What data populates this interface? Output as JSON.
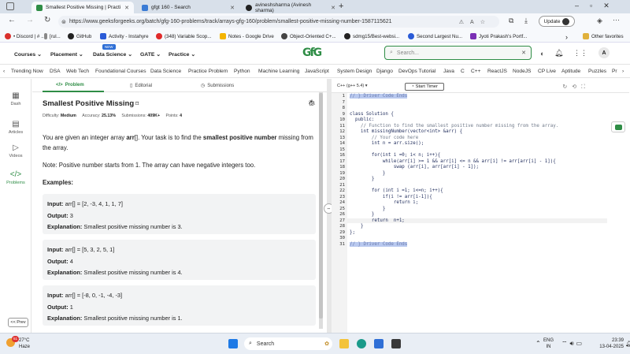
{
  "browser": {
    "tabs": [
      {
        "title": "Smallest Positive Missing | Practi",
        "active": true
      },
      {
        "title": "gfgt 160 - Search",
        "active": false
      },
      {
        "title": "avineshsharma (Avinesh sharma)",
        "active": false
      }
    ],
    "url": "https://www.geeksforgeeks.org/batch/gfg-160-problems/track/arrays-gfg-160/problem/smallest-positive-missing-number-1587115621",
    "update_label": "Update",
    "bookmarks": [
      "• Discord | # ...",
      "[rul...",
      "GitHub",
      "Activity - Instahyre",
      "(348) Variable Scop...",
      "Notes - Google Drive",
      "Object-Oriented C+...",
      "sdmg15/Best-websi...",
      "Second Largest Nu...",
      "Jyoti Prakash's Portf..."
    ],
    "other_favorites": "Other favorites"
  },
  "site": {
    "logo": "GfG",
    "nav": [
      "Courses",
      "Placement",
      "Data Science",
      "GATE",
      "Practice"
    ],
    "new_badge": "NEW",
    "search_placeholder": "Search...",
    "avatar_letter": "A",
    "categories": [
      "Trending Now",
      "DSA",
      "Web Tech",
      "Foundational Courses",
      "Data Science",
      "Practice Problem",
      "Python",
      "Machine Learning",
      "JavaScript",
      "System Design",
      "Django",
      "DevOps Tutorial",
      "Java",
      "C",
      "C++",
      "ReactJS",
      "NodeJS",
      "CP Live",
      "Aptitude",
      "Puzzles",
      "Pr"
    ]
  },
  "rail": {
    "items": [
      "Dash",
      "Articles",
      "Videos",
      "Problems"
    ],
    "prev_label": "<< Prev"
  },
  "problem": {
    "tabs": [
      "Problem",
      "Editorial",
      "Submissions"
    ],
    "title": "Smallest Positive Missing",
    "difficulty_label": "Difficulty:",
    "difficulty": "Medium",
    "accuracy_label": "Accuracy:",
    "accuracy": "25.13%",
    "submissions_label": "Submissions:",
    "submissions": "409K+",
    "points_label": "Points:",
    "points": "4",
    "desc_1": "You are given an integer array ",
    "desc_arr": "arr",
    "desc_2": "[]. Your task is to find the ",
    "desc_bold": "smallest positive number",
    "desc_3": " missing from the array.",
    "note": "Note: Positive number starts from 1. The array can have negative integers too.",
    "examples_heading": "Examples:",
    "input_label": "Input:",
    "output_label": "Output:",
    "explanation_label": "Explanation:",
    "examples": [
      {
        "input": "arr[] = [2, -3, 4, 1, 1, 7]",
        "output": "3",
        "explanation": "Smallest positive missing number is 3."
      },
      {
        "input": "arr[] = [5, 3, 2, 5, 1]",
        "output": "4",
        "explanation": "Smallest positive missing number is 4."
      },
      {
        "input": "arr[] = [-8, 0, -1, -4, -3]",
        "output": "1",
        "explanation": "Smallest positive missing number is 1."
      }
    ]
  },
  "editor": {
    "language": "C++ (g++ 5.4)",
    "timer_label": "Start Timer",
    "lines": [
      {
        "n": "1",
        "text": "// } Driver Code Ends",
        "kind": "hl"
      },
      {
        "n": "7",
        "text": "",
        "kind": ""
      },
      {
        "n": "8",
        "text": "",
        "kind": ""
      },
      {
        "n": "9",
        "text": "class Solution {",
        "kind": ""
      },
      {
        "n": "10",
        "text": "  public:",
        "kind": ""
      },
      {
        "n": "11",
        "text": "    // Function to find the smallest positive number missing from the array.",
        "kind": "cm"
      },
      {
        "n": "12",
        "text": "    int missingNumber(vector<int> &arr) {",
        "kind": ""
      },
      {
        "n": "13",
        "text": "        // Your code here",
        "kind": "cm"
      },
      {
        "n": "14",
        "text": "        int n = arr.size();",
        "kind": ""
      },
      {
        "n": "15",
        "text": "",
        "kind": ""
      },
      {
        "n": "16",
        "text": "        for(int i =0; i< n; i++){",
        "kind": ""
      },
      {
        "n": "17",
        "text": "            while(arr[i] >= 1 && arr[i] <= n && arr[i] != arr[arr[i] - 1]){",
        "kind": ""
      },
      {
        "n": "18",
        "text": "                swap (arr[i], arr[arr[i] - 1]);",
        "kind": ""
      },
      {
        "n": "19",
        "text": "            }",
        "kind": ""
      },
      {
        "n": "20",
        "text": "        }",
        "kind": ""
      },
      {
        "n": "21",
        "text": "",
        "kind": ""
      },
      {
        "n": "22",
        "text": "        for (int i =1; i<=n; i++){",
        "kind": ""
      },
      {
        "n": "23",
        "text": "            if(i != arr[i-1]){",
        "kind": ""
      },
      {
        "n": "24",
        "text": "                return i;",
        "kind": ""
      },
      {
        "n": "25",
        "text": "            }",
        "kind": ""
      },
      {
        "n": "26",
        "text": "        }",
        "kind": ""
      },
      {
        "n": "27",
        "text": "        return  n+1;",
        "kind": ""
      },
      {
        "n": "28",
        "text": "    }",
        "kind": ""
      },
      {
        "n": "29",
        "text": "};",
        "kind": ""
      },
      {
        "n": "30",
        "text": "",
        "kind": ""
      },
      {
        "n": "31",
        "text": "// } Driver Code Ends",
        "kind": "hl"
      }
    ]
  },
  "taskbar": {
    "weather_temp": "27°C",
    "weather_desc": "Haze",
    "search_label": "Search",
    "lang_top": "ENG",
    "lang_bottom": "IN",
    "time": "23:39",
    "date": "13-04-2025",
    "badge": "51"
  }
}
